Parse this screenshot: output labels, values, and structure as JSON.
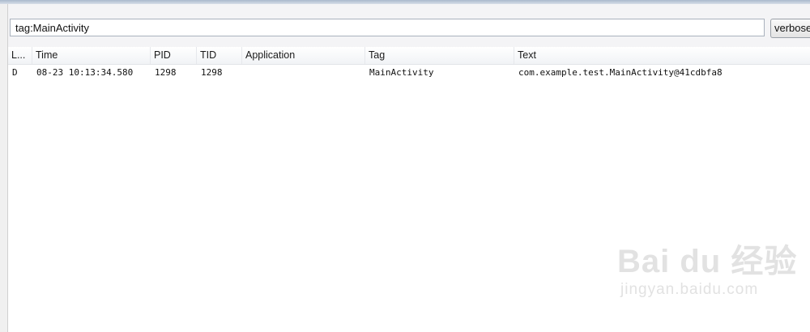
{
  "filter": {
    "query": "tag:MainActivity",
    "log_level": "verbose"
  },
  "table": {
    "columns": [
      "L...",
      "Time",
      "PID",
      "TID",
      "Application",
      "Tag",
      "Text"
    ],
    "rows": [
      {
        "level": "D",
        "time": "08-23 10:13:34.580",
        "pid": "1298",
        "tid": "1298",
        "application": "",
        "tag": "MainActivity",
        "text": "com.example.test.MainActivity@41cdbfa8"
      }
    ]
  },
  "watermark": {
    "logo": "Bai du 经验",
    "url": "jingyan.baidu.com"
  }
}
